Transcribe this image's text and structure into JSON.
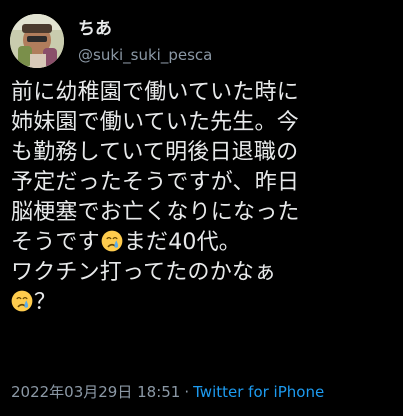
{
  "author": {
    "display_name": "ちあ",
    "handle": "@suki_suki_pesca"
  },
  "tweet": {
    "lines": [
      "前に幼稚園で働いていた時に",
      "姉妹園で働いていた先生。今",
      "も勤務していて明後日退職の",
      "予定だったそうですが、昨日",
      "脳梗塞でお亡くなりになった"
    ],
    "line6_before": "そうです",
    "line6_after": "まだ40代。",
    "line7": "ワクチン打ってたのかなぁ",
    "line8_after": "？",
    "emoji": "crying-face"
  },
  "meta": {
    "timestamp": "2022年03月29日 18:51",
    "separator": "·",
    "source": "Twitter for iPhone"
  },
  "colors": {
    "background": "#000000",
    "text": "#e7e9ea",
    "secondary": "#8b98a5",
    "link": "#1d9bf0"
  }
}
